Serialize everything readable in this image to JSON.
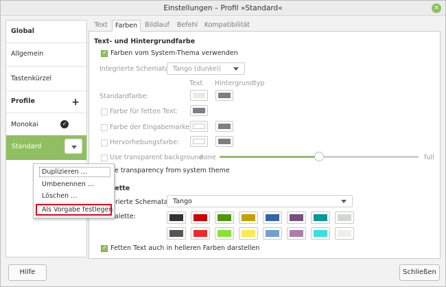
{
  "window": {
    "title": "Einstellungen – Profil »Standard«"
  },
  "sidebar": {
    "global_header": "Global",
    "items_global": [
      "Allgemein",
      "Tastenkürzel"
    ],
    "profiles_header": "Profile",
    "profiles": [
      "Monokai",
      "Standard"
    ]
  },
  "context_menu": {
    "items": [
      "Duplizieren …",
      "Umbenennen …",
      "Löschen …",
      "Als Vorgabe festlegen"
    ]
  },
  "tabs": [
    "Text",
    "Farben",
    "Bildlauf",
    "Befehl",
    "Kompatibilität"
  ],
  "colors": {
    "section_title": "Text- und Hintergrundfarbe",
    "use_system_theme": "Farben vom System-Thema verwenden",
    "builtin_schemes_label": "Integrierte Schemata:",
    "builtin_schemes_value": "Tango (dunkel)",
    "col_text": "Text",
    "col_background": "Hintergrundtyp",
    "default_color": "Standardfarbe:",
    "bold_color": "Farbe für fetten Text:",
    "cursor_color": "Farbe der Eingabemarke:",
    "highlight_color": "Hervorhebungsfarbe:",
    "transparent_bg": "Use transparent background",
    "slider_min": "none",
    "slider_max": "full",
    "transparency_system": "se transparency from system theme",
    "palette_title": "lette",
    "palette_schemes_label": "rierte Schemata:",
    "palette_schemes_value": "Tango",
    "palette_label": "alette:",
    "bold_bright": "Fetten Text auch in helleren Farben darstellen"
  },
  "palette_row1": [
    "#2e3436",
    "#cc0000",
    "#4e9a06",
    "#c4a000",
    "#3465a4",
    "#75507b",
    "#06989a",
    "#d3d7cf"
  ],
  "palette_row2": [
    "#555753",
    "#ef2929",
    "#8ae234",
    "#fce94f",
    "#729fcf",
    "#ad7fa8",
    "#34e2e2",
    "#eeeeec"
  ],
  "footer": {
    "help": "Hilfe",
    "close": "Schließen"
  },
  "accent": "#8fbf61",
  "highlight_border": "#e1001a"
}
